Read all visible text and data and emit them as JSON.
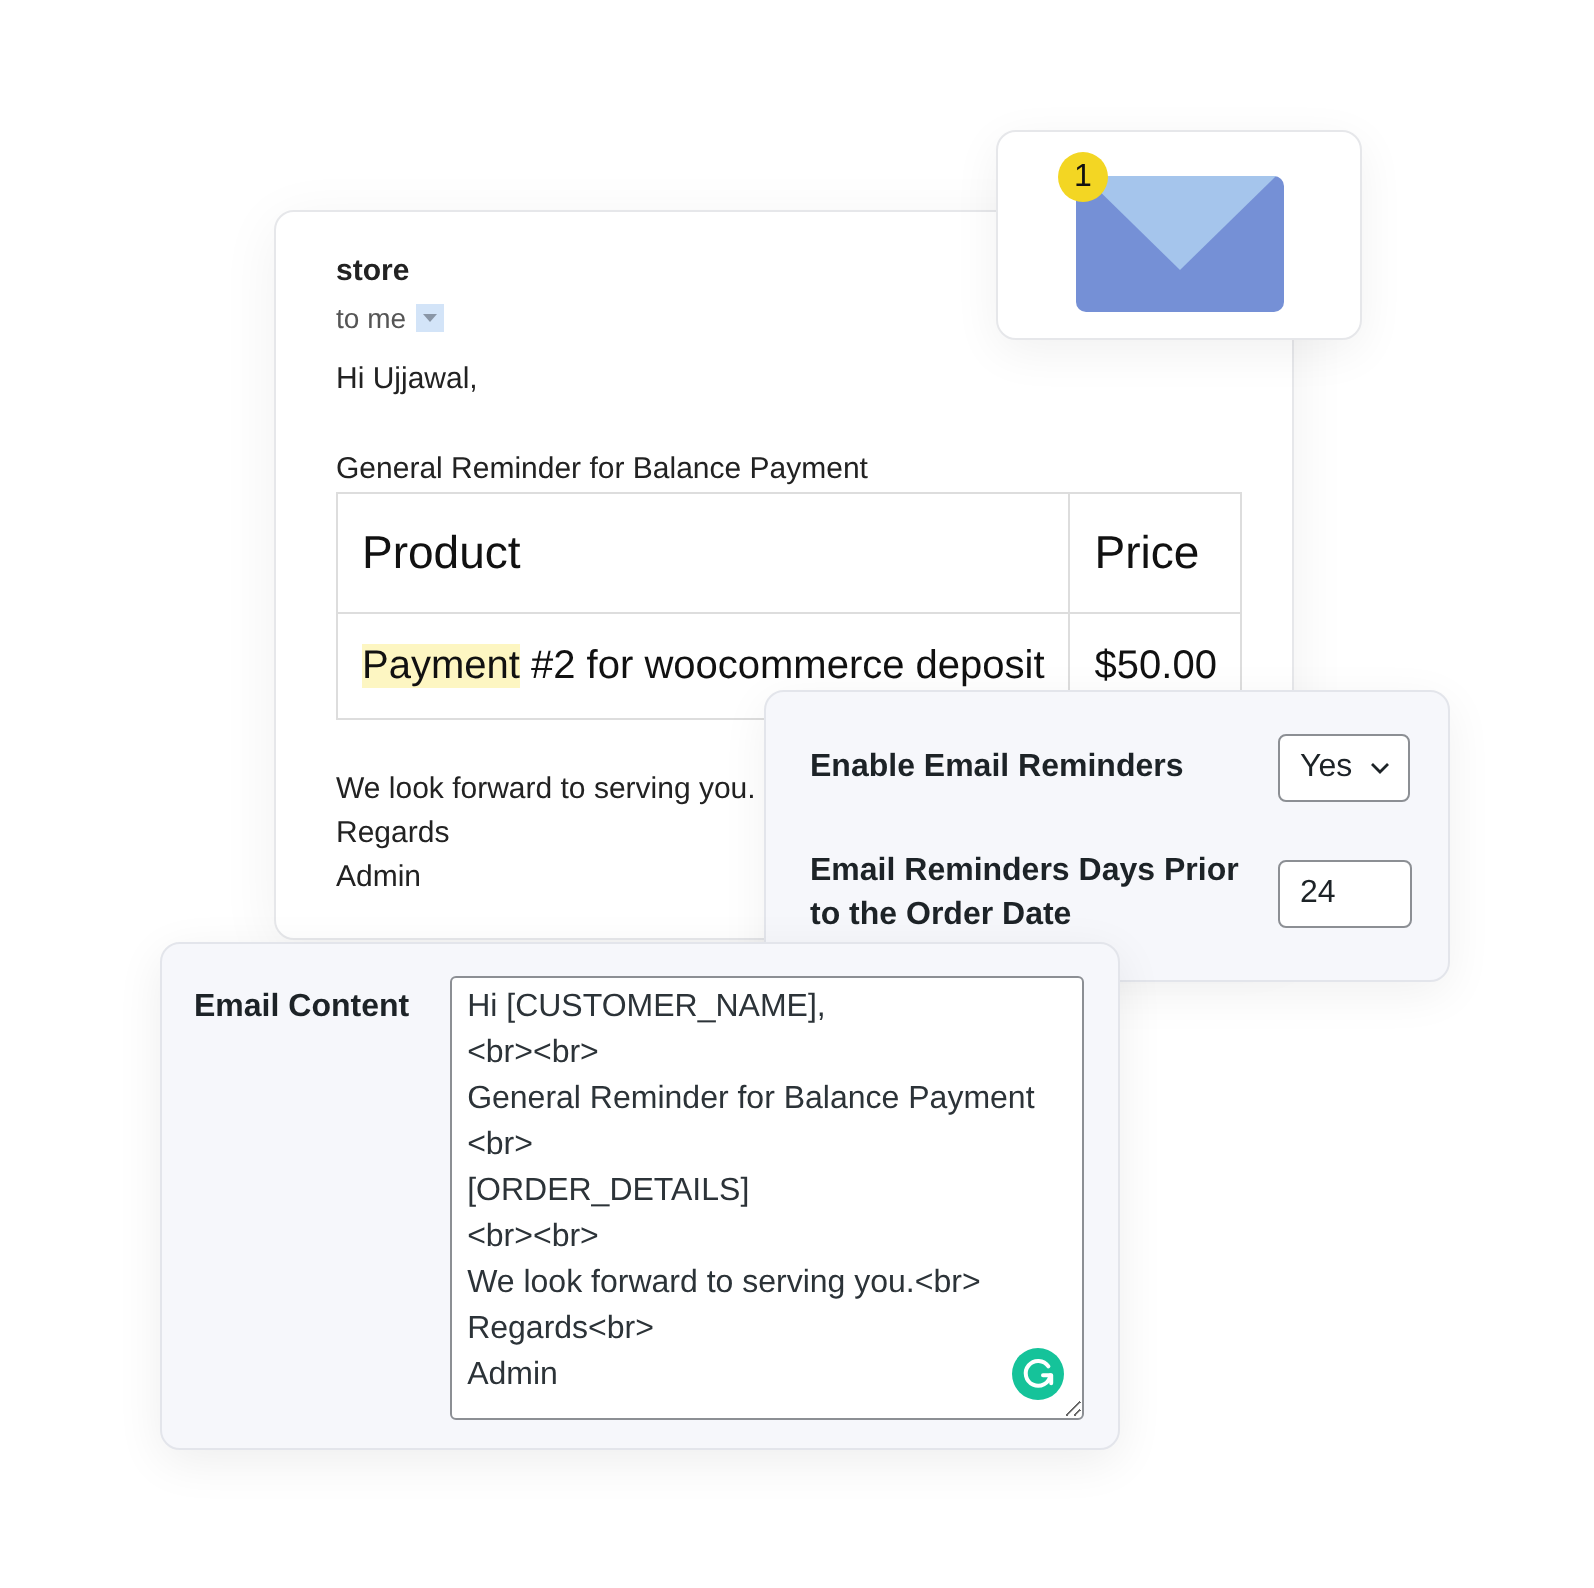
{
  "notification": {
    "badge": "1"
  },
  "email": {
    "sender": "store",
    "recipient": "to me",
    "greeting": "Hi Ujjawal,",
    "intro": "General Reminder for Balance Payment",
    "table": {
      "columns": [
        "Product",
        "Price"
      ],
      "rows": [
        {
          "product": [
            {
              "text": "Payment",
              "highlighted": true
            },
            {
              "text": "#2 for woocommerce deposit",
              "highlighted": false
            }
          ],
          "price": "$50.00"
        }
      ]
    },
    "closing": [
      "We look forward to serving you.",
      "Regards",
      "Admin"
    ]
  },
  "settings": {
    "fields": [
      {
        "kind": "select",
        "label": "Enable Email Reminders",
        "value": "Yes"
      },
      {
        "kind": "number",
        "label": "Email Reminders Days Prior to the Order Date",
        "value": "24"
      }
    ]
  },
  "content": {
    "label": "Email Content",
    "value": "Hi [CUSTOMER_NAME],\n<br><br>\nGeneral Reminder for Balance Payment\n<br>\n[ORDER_DETAILS]\n<br><br>\nWe look forward to serving you.<br>\nRegards<br>\nAdmin"
  }
}
